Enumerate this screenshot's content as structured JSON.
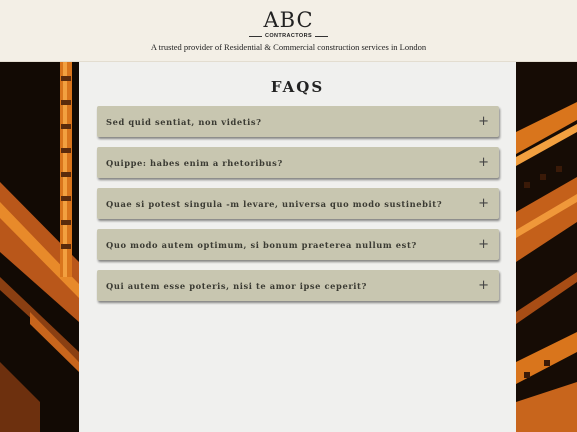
{
  "header": {
    "logo_title": "ABC",
    "logo_subtitle": "CONTRACTORS",
    "tagline": "A trusted provider of Residential & Commercial construction services in London"
  },
  "faq": {
    "title": "FAQS",
    "items": [
      {
        "question": "Sed quid sentiat, non videtis?",
        "icon": "+"
      },
      {
        "question": "Quippe: habes enim a rhetoribus?",
        "icon": "+"
      },
      {
        "question": "Quae si potest singula -m levare, universa quo modo sustinebit?",
        "icon": "+"
      },
      {
        "question": "Quo modo autem optimum, si bonum praeterea nullum est?",
        "icon": "+"
      },
      {
        "question": "Qui autem esse poteris, nisi te amor ipse ceperit?",
        "icon": "+"
      }
    ]
  },
  "colors": {
    "header_bg": "#f3efe6",
    "panel_bg": "#f0f0ee",
    "accordion_bg": "#c8c6b0",
    "steel_orange": "#d9751c"
  }
}
